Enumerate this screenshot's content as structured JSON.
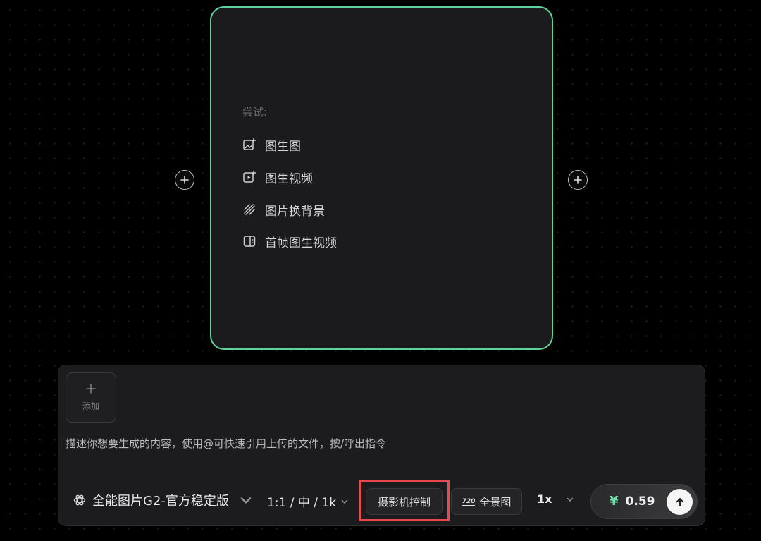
{
  "card": {
    "try_label": "尝试:",
    "suggestions": [
      {
        "icon": "image-sparkle-icon",
        "label": "图生图"
      },
      {
        "icon": "video-sparkle-icon",
        "label": "图生视频"
      },
      {
        "icon": "diagonal-stripes-icon",
        "label": "图片换背景"
      },
      {
        "icon": "split-frame-icon",
        "label": "首帧图生视频"
      }
    ],
    "border_color": "#5fd39a"
  },
  "composer": {
    "add_label": "添加",
    "prompt_placeholder": "描述你想要生成的内容，使用@可快速引用上传的文件，按/呼出指令",
    "model": "全能图片G2-官方稳定版",
    "ratio": "1:1 / 中 / 1k",
    "camera_control": "摄影机控制",
    "panorama": "全景图",
    "panorama_badge": "720",
    "multiplier": "1x",
    "currency": "¥",
    "price": "0.59"
  },
  "colors": {
    "accent_green": "#5fd39a",
    "highlight_red": "#e8494f"
  }
}
